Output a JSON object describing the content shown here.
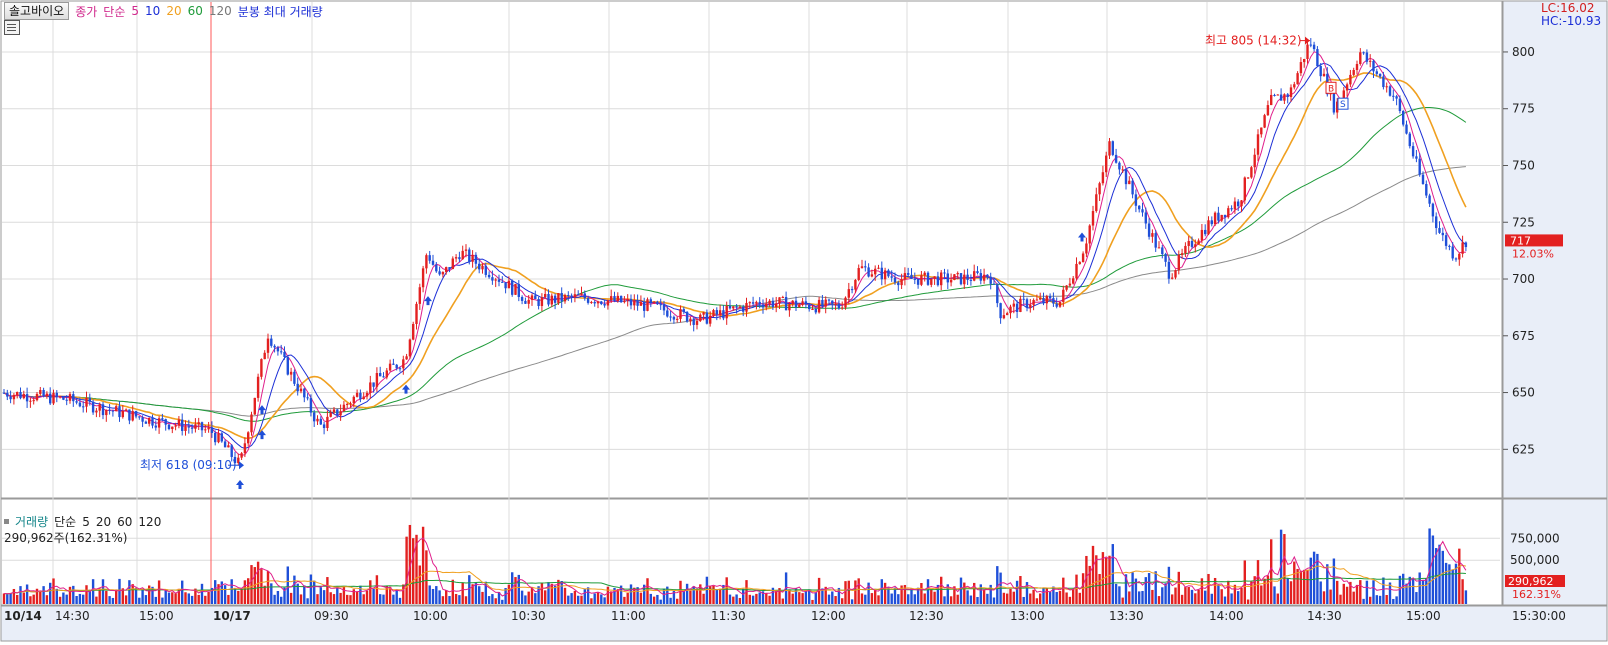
{
  "header": {
    "stock_name": "솔고바이오",
    "price_label": "종가",
    "ma_type": "단순",
    "ma_periods": [
      "5",
      "10",
      "20",
      "60",
      "120"
    ],
    "extra_label": "분봉 최대 거래량"
  },
  "volume_header": {
    "label": "거래량",
    "ma_type": "단순",
    "ma_periods": [
      "5",
      "20",
      "60",
      "120"
    ],
    "current_volume_text": "290,962주(162.31%)"
  },
  "lc_hc": {
    "lc": "LC:16.02",
    "hc": "HC:-10.93"
  },
  "price_axis": {
    "ticks": [
      "800",
      "775",
      "750",
      "725",
      "700",
      "675",
      "650",
      "625"
    ],
    "tick_values": [
      800,
      775,
      750,
      725,
      700,
      675,
      650,
      625
    ],
    "range": [
      604,
      822
    ],
    "current_price": "717",
    "current_change": "12.03%"
  },
  "volume_axis": {
    "ticks": [
      "750,000",
      "500,000"
    ],
    "tick_values": [
      750000,
      500000
    ],
    "max": 1050000,
    "current_volume": "290,962",
    "current_ratio": "162.31%"
  },
  "time_axis": {
    "labels": [
      "10/14",
      "14:30",
      "15:00",
      "10/17",
      "09:30",
      "10:00",
      "10:30",
      "11:00",
      "11:30",
      "12:00",
      "12:30",
      "13:00",
      "13:30",
      "14:00",
      "14:30",
      "15:00"
    ],
    "end_label": "15:30:00"
  },
  "annotations": {
    "high": "최고 805 (14:32)",
    "low": "최저 618 (09:10)",
    "buy_marker": "B",
    "sell_marker": "S"
  },
  "colors": {
    "up": "#e32020",
    "down": "#1f4fd8",
    "ma5": "#e0208c",
    "ma10": "#1c2fd6",
    "ma20": "#f0a020",
    "ma60": "#1f9b3a",
    "ma120": "#8a8a8a",
    "grid": "#dcdcdc",
    "axis_bg": "#e9eef8",
    "day_divider": "#ff5a5a"
  },
  "chart_data": {
    "type": "line",
    "title": "",
    "xlabel": "",
    "ylabel": "",
    "ylim": [
      604,
      822
    ],
    "x": [
      "10/14 14:00",
      "10/14 14:30",
      "10/14 15:00",
      "10/17 09:00",
      "09:10",
      "09:20",
      "09:30",
      "09:40",
      "09:50",
      "10:00",
      "10:05",
      "10:10",
      "10:20",
      "10:30",
      "10:40",
      "10:50",
      "11:00",
      "11:15",
      "11:30",
      "11:45",
      "12:00",
      "12:07",
      "12:15",
      "12:30",
      "12:45",
      "13:00",
      "13:10",
      "13:15",
      "13:25",
      "13:30",
      "13:35",
      "13:45",
      "13:55",
      "14:00",
      "14:10",
      "14:20",
      "14:25",
      "14:32",
      "14:40",
      "14:50",
      "15:00",
      "15:10",
      "15:15",
      "15:20",
      "15:25"
    ],
    "series": [
      {
        "values": [
          650,
          647,
          638,
          633,
          618,
          676,
          635,
          650,
          665,
          712,
          700,
          712,
          700,
          690,
          692,
          690,
          688,
          682,
          690,
          688,
          688,
          705,
          700,
          700,
          702,
          685,
          690,
          690,
          715,
          760,
          730,
          702,
          715,
          725,
          735,
          778,
          782,
          805,
          775,
          800,
          780,
          745,
          720,
          710,
          717
        ]
      }
    ]
  }
}
